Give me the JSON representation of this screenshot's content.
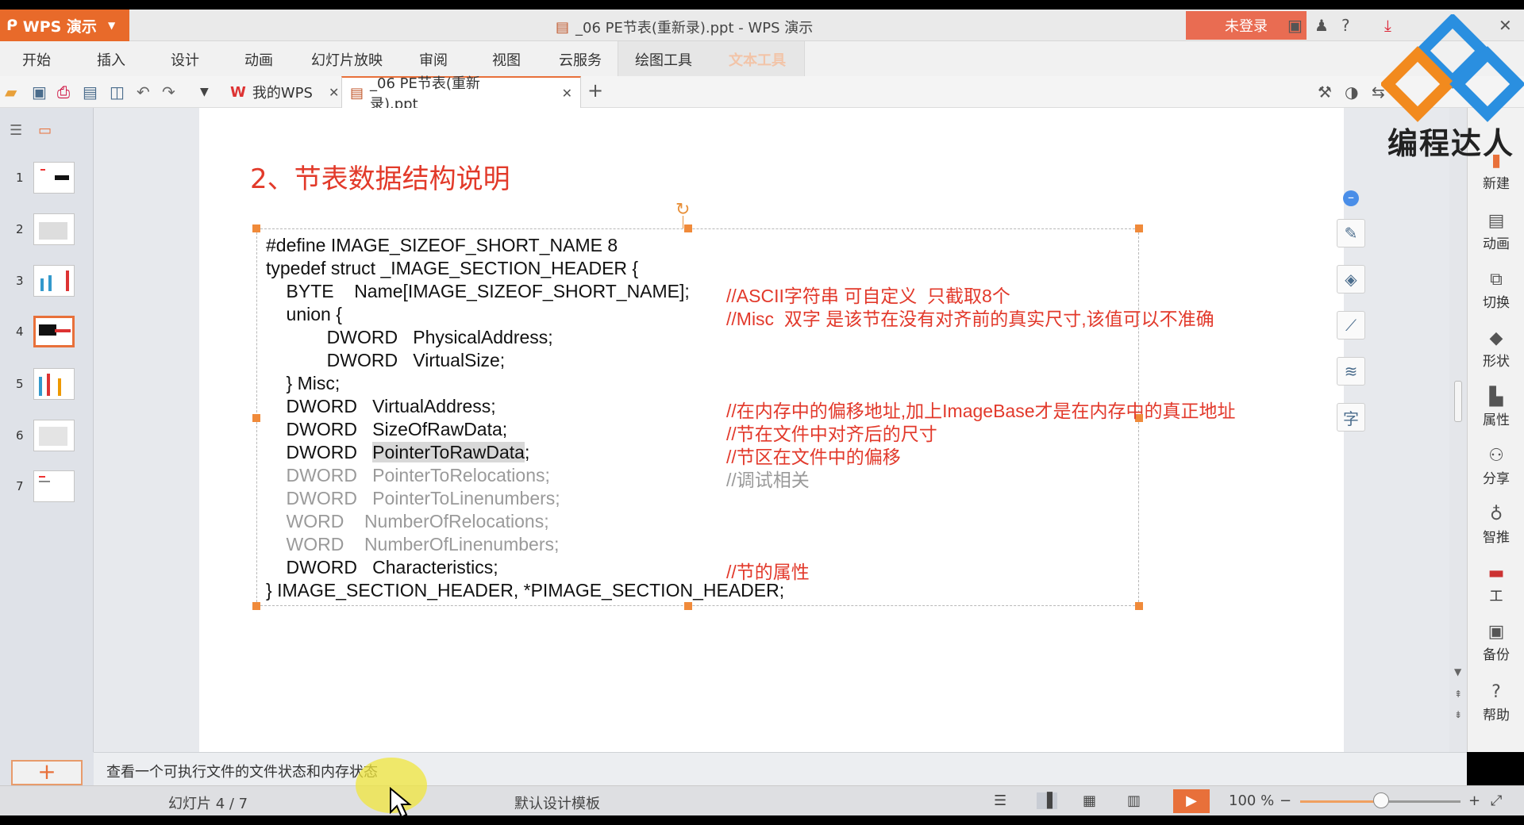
{
  "app": {
    "name": "WPS 演示",
    "window_title": "_06 PE节表(重新录).ppt - WPS 演示",
    "login_label": "未登录"
  },
  "ribbon": {
    "tabs": [
      "开始",
      "插入",
      "设计",
      "动画",
      "幻灯片放映",
      "审阅",
      "视图",
      "云服务",
      "绘图工具",
      "文本工具"
    ]
  },
  "doc_tabs": {
    "home": "我的WPS",
    "active": "_06 PE节表(重新录).ppt"
  },
  "thumbnails": {
    "numbers": [
      "1",
      "2",
      "3",
      "4",
      "5",
      "6",
      "7"
    ],
    "active_index": 4
  },
  "slide": {
    "title": "2、节表数据结构说明",
    "lines": [
      {
        "code": "#define IMAGE_SIZEOF_SHORT_NAME 8",
        "comment": ""
      },
      {
        "code": "typedef struct _IMAGE_SECTION_HEADER {",
        "comment": ""
      },
      {
        "code": "    BYTE    Name[IMAGE_SIZEOF_SHORT_NAME];",
        "comment": "//ASCII字符串 可自定义  只截取8个"
      },
      {
        "code": "    union {",
        "comment": "//Misc  双字 是该节在没有对齐前的真实尺寸,该值可以不准确"
      },
      {
        "code": "            DWORD   PhysicalAddress;",
        "comment": ""
      },
      {
        "code": "            DWORD   VirtualSize;",
        "comment": ""
      },
      {
        "code": "    } Misc;",
        "comment": ""
      },
      {
        "code": "    DWORD   VirtualAddress;",
        "comment": "//在内存中的偏移地址,加上ImageBase才是在内存中的真正地址"
      },
      {
        "code": "    DWORD   SizeOfRawData;",
        "comment": "//节在文件中对齐后的尺寸"
      },
      {
        "code_pre": "    DWORD   ",
        "code_hl": "PointerToRawData",
        "code_post": ";",
        "comment": "//节区在文件中的偏移"
      },
      {
        "code": "    DWORD   PointerToRelocations;",
        "comment": "//调试相关",
        "gray": true
      },
      {
        "code": "    DWORD   PointerToLinenumbers;",
        "comment": "",
        "gray": true
      },
      {
        "code": "    WORD    NumberOfRelocations;",
        "comment": "",
        "gray": true
      },
      {
        "code": "    WORD    NumberOfLinenumbers;",
        "comment": "",
        "gray": true
      },
      {
        "code": "    DWORD   Characteristics;",
        "comment": "//节的属性"
      },
      {
        "code": "} IMAGE_SECTION_HEADER, *PIMAGE_SECTION_HEADER;",
        "comment": ""
      }
    ]
  },
  "right_pane": {
    "items": [
      "新建",
      "动画",
      "切换",
      "形状",
      "属性",
      "分享",
      "智推",
      "工",
      "备份",
      "帮助"
    ]
  },
  "notes": {
    "text": "查看一个可执行文件的文件状态和内存状态"
  },
  "status": {
    "slide_counter": "幻灯片 4 / 7",
    "template": "默认设计模板",
    "zoom": "100 %"
  },
  "watermark": {
    "text": "编程达人",
    "colors": {
      "orange": "#f28a1e",
      "blue": "#2a8fe0"
    }
  },
  "colors": {
    "accent": "#e8703a",
    "title_red": "#e23a2a",
    "comment_red": "#e2392b"
  }
}
